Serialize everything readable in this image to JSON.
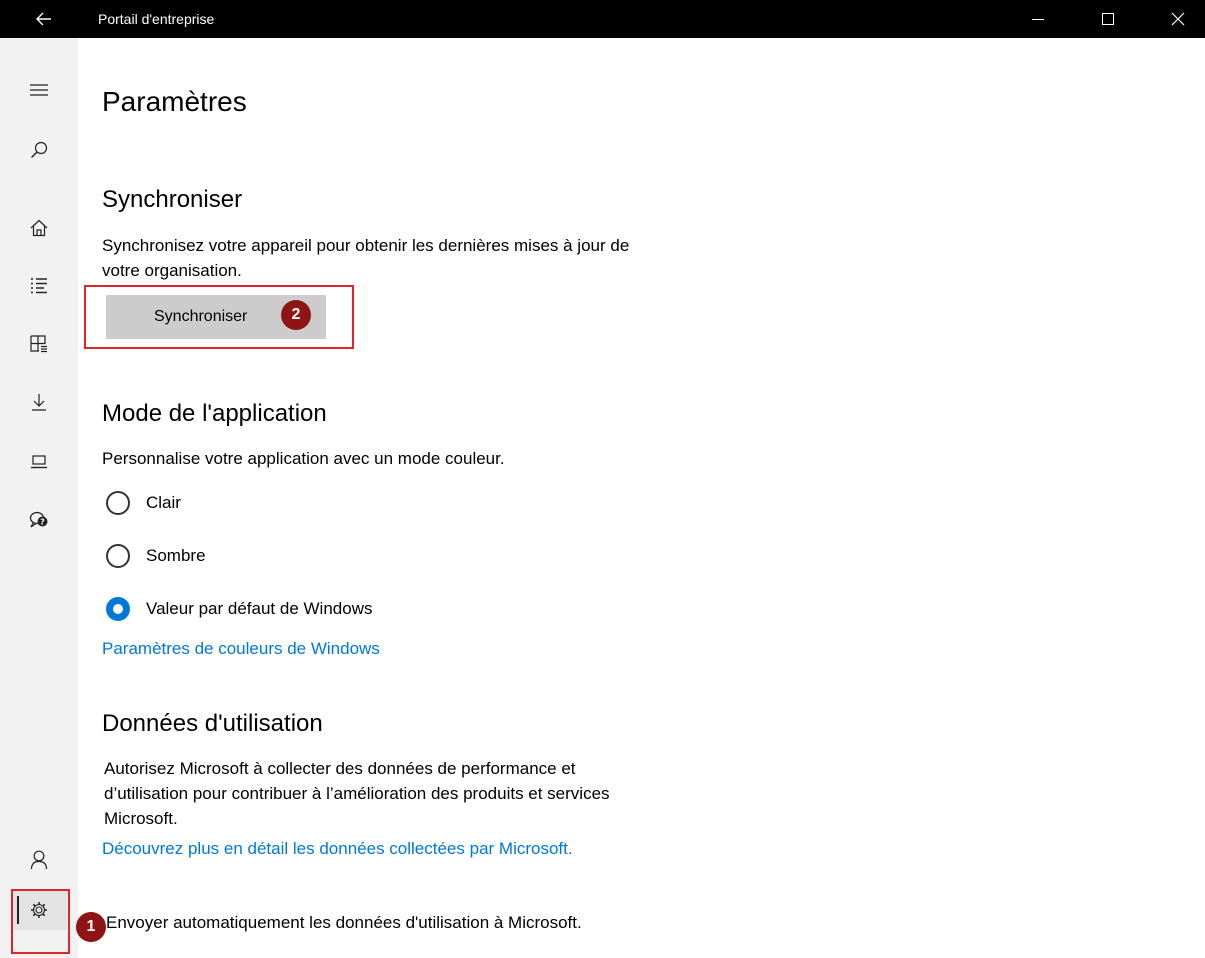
{
  "window": {
    "title": "Portail d'entreprise",
    "back_icon": "arrow-left-icon",
    "minimize_icon": "minimize-icon",
    "maximize_icon": "maximize-icon",
    "close_icon": "close-icon"
  },
  "rail": {
    "items": [
      {
        "name": "menu-icon"
      },
      {
        "name": "search-icon"
      },
      {
        "name": "home-icon"
      },
      {
        "name": "list-icon"
      },
      {
        "name": "apps-grid-icon"
      },
      {
        "name": "download-icon"
      },
      {
        "name": "device-icon"
      },
      {
        "name": "help-chat-icon"
      },
      {
        "name": "person-icon"
      },
      {
        "name": "gear-icon"
      }
    ]
  },
  "annotations": {
    "badge_1": "1",
    "badge_2": "2",
    "color": "#e0242b",
    "badge_color": "#8f1414"
  },
  "page": {
    "title": "Paramètres"
  },
  "sync": {
    "heading": "Synchroniser",
    "description": "Synchronisez votre appareil pour obtenir les dernières mises à jour de votre organisation.",
    "button_label": "Synchroniser"
  },
  "app_mode": {
    "heading": "Mode de l'application",
    "description": "Personnalise votre application avec un mode couleur.",
    "options": [
      {
        "label": "Clair",
        "selected": false
      },
      {
        "label": "Sombre",
        "selected": false
      },
      {
        "label": "Valeur par défaut de Windows",
        "selected": true
      }
    ],
    "link": "Paramètres de couleurs de Windows"
  },
  "usage": {
    "heading": "Données d'utilisation",
    "description": "Autorisez Microsoft à collecter des données de performance et d’utilisation pour contribuer à l’amélioration des produits et services Microsoft.",
    "link": "Découvrez plus en détail les données collectées par Microsoft.",
    "auto_send": "Envoyer automatiquement les données d'utilisation à Microsoft."
  },
  "colors": {
    "accent": "#0078d7",
    "titlebar": "#000000",
    "rail_bg": "#f2f2f2",
    "button_bg": "#cccccc"
  }
}
